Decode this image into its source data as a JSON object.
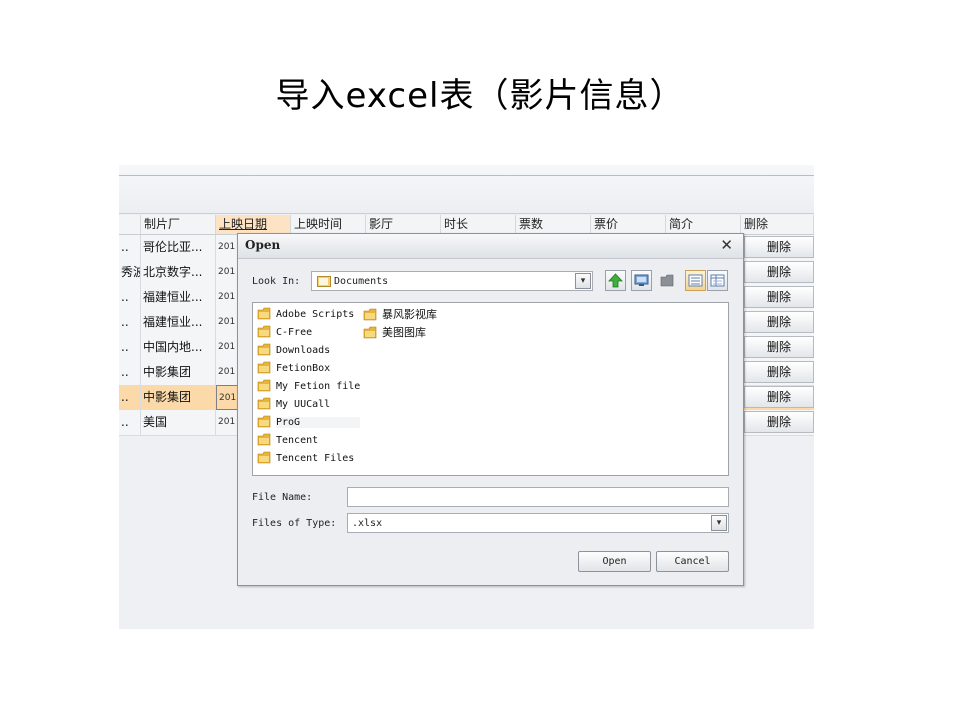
{
  "slide": {
    "title": "导入excel表（影片信息）"
  },
  "grid": {
    "headers": [
      "制片厂",
      "上映日期",
      "上映时间",
      "影厅",
      "时长",
      "票数",
      "票价",
      "简介",
      "删除"
    ],
    "rows": [
      {
        "lead": "..",
        "studio": "哥伦比亚...",
        "date": "201",
        "action": "删除"
      },
      {
        "lead": "秀波",
        "studio": "北京数字...",
        "date": "201",
        "action": "删除"
      },
      {
        "lead": "..",
        "studio": "福建恒业...",
        "date": "201",
        "action": "删除"
      },
      {
        "lead": "..",
        "studio": "福建恒业...",
        "date": "201",
        "action": "删除"
      },
      {
        "lead": "..",
        "studio": "中国内地...",
        "date": "201",
        "action": "删除"
      },
      {
        "lead": "..",
        "studio": "中影集团",
        "date": "201",
        "action": "删除"
      },
      {
        "lead": "..",
        "studio": "中影集团",
        "date": "201",
        "action": "删除",
        "highlighted": true
      },
      {
        "lead": "..",
        "studio": "美国",
        "date": "201",
        "action": "删除"
      }
    ]
  },
  "dialog": {
    "title": "Open",
    "close": "✕",
    "look_in_label": "Look In:",
    "look_in_value": "Documents",
    "files_col1": [
      "Adobe Scripts",
      "C-Free",
      "Downloads",
      "FetionBox",
      "My Fetion file",
      "My UUCall",
      "ProG",
      "Tencent",
      "Tencent Files"
    ],
    "files_col2": [
      "暴风影视库",
      "美图图库"
    ],
    "file_name_label": "File Name:",
    "file_name_value": "",
    "file_type_label": "Files of Type:",
    "file_type_value": ".xlsx",
    "open_label": "Open",
    "cancel_label": "Cancel"
  },
  "colors": {
    "accent": "#e8b27a",
    "highlight_row": "#fcd9a9",
    "folder": "#e9b43a"
  }
}
